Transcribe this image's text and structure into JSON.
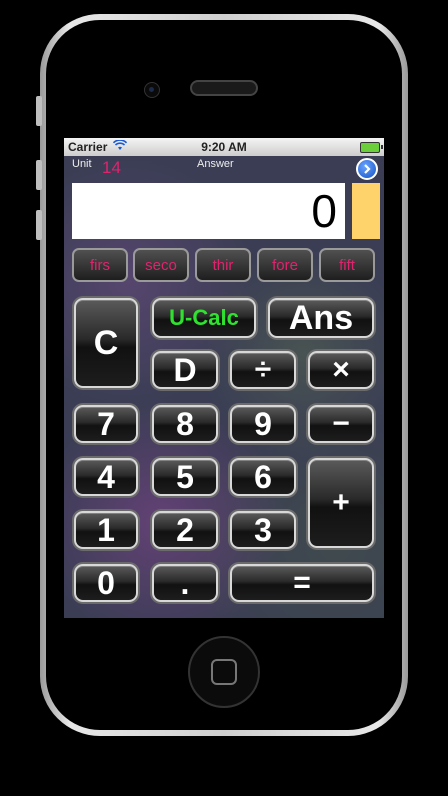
{
  "status_bar": {
    "carrier": "Carrier",
    "time": "9:20 AM"
  },
  "header": {
    "unit_label": "Unit",
    "unit_value": "14",
    "answer_label": "Answer",
    "next_icon": "chevron-right-icon"
  },
  "display": {
    "value": "0",
    "memory_color": "#ffd36b"
  },
  "unit_buttons": [
    "firs",
    "seco",
    "thir",
    "fore",
    "fift"
  ],
  "keys": {
    "clear": "C",
    "ucalc": "U-Calc",
    "ans": "Ans",
    "d": "D",
    "divide": "÷",
    "multiply": "×",
    "seven": "7",
    "eight": "8",
    "nine": "9",
    "minus": "−",
    "four": "4",
    "five": "5",
    "six": "6",
    "plus": "+",
    "one": "1",
    "two": "2",
    "three": "3",
    "zero": "0",
    "dot": ".",
    "equals": "="
  },
  "colors": {
    "accent_pink": "#e0236d",
    "ucalc_green": "#2fe22f"
  }
}
